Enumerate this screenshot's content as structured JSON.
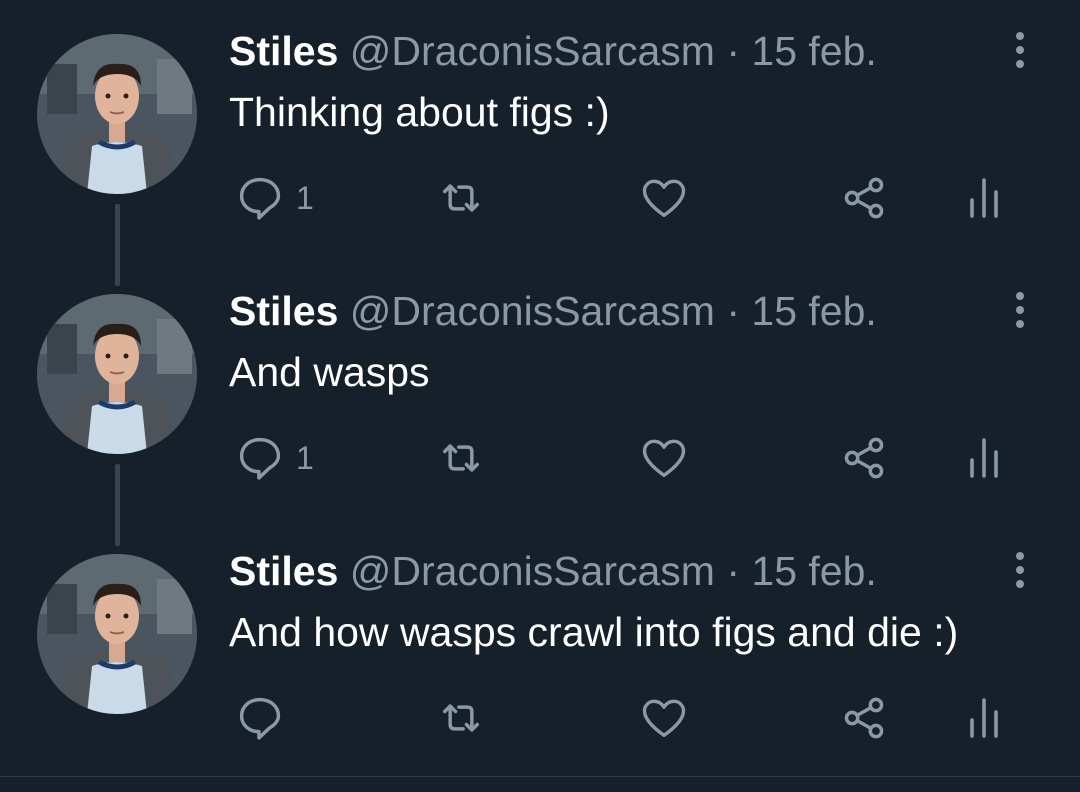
{
  "colors": {
    "background": "#15202b",
    "primary_text": "#ffffff",
    "secondary_text": "#8b98a5",
    "thread_line": "#38444d"
  },
  "tweets": [
    {
      "name": "Stiles",
      "handle": "@DraconisSarcasm",
      "separator": "·",
      "date": "15 feb.",
      "text": "Thinking about figs :)",
      "reply_count": "1",
      "icons": [
        "reply-icon",
        "retweet-icon",
        "like-icon",
        "share-icon",
        "analytics-icon",
        "more-icon"
      ]
    },
    {
      "name": "Stiles",
      "handle": "@DraconisSarcasm",
      "separator": "·",
      "date": "15 feb.",
      "text": "And wasps",
      "reply_count": "1",
      "icons": [
        "reply-icon",
        "retweet-icon",
        "like-icon",
        "share-icon",
        "analytics-icon",
        "more-icon"
      ]
    },
    {
      "name": "Stiles",
      "handle": "@DraconisSarcasm",
      "separator": "·",
      "date": "15 feb.",
      "text": "And how wasps crawl into figs and die :)",
      "reply_count": "",
      "icons": [
        "reply-icon",
        "retweet-icon",
        "like-icon",
        "share-icon",
        "analytics-icon",
        "more-icon"
      ]
    }
  ]
}
